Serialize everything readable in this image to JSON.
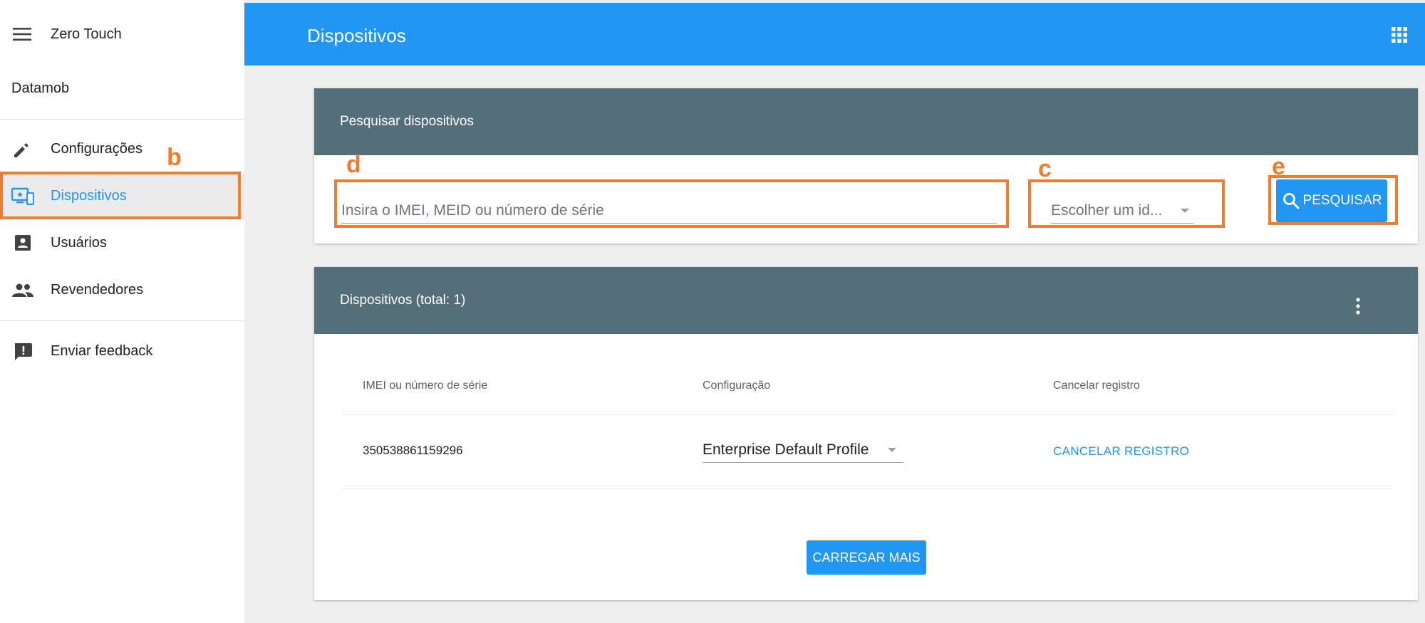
{
  "sidebar": {
    "app_title": "Zero Touch",
    "org_name": "Datamob",
    "items": [
      {
        "label": "Configurações",
        "icon": "pencil-icon",
        "active": false
      },
      {
        "label": "Dispositivos",
        "icon": "devices-icon",
        "active": true
      },
      {
        "label": "Usuários",
        "icon": "account-box-icon",
        "active": false
      },
      {
        "label": "Revendedores",
        "icon": "people-icon",
        "active": false
      }
    ],
    "feedback": {
      "label": "Enviar feedback",
      "icon": "feedback-icon"
    }
  },
  "header": {
    "title": "Dispositivos",
    "apps_icon": "apps-grid-icon"
  },
  "search_card": {
    "title": "Pesquisar dispositivos",
    "input_placeholder": "Insira o IMEI, MEID ou número de série",
    "id_select_value": "Escolher um id...",
    "search_button_label": "PESQUISAR"
  },
  "devices_card": {
    "title": "Dispositivos (total: 1)",
    "columns": [
      "IMEI ou número de série",
      "Configuração",
      "Cancelar registro"
    ],
    "rows": [
      {
        "imei": "350538861159296",
        "config": "Enterprise Default Profile",
        "action": "CANCELAR REGISTRO"
      }
    ],
    "load_more_label": "CARREGAR MAIS"
  },
  "annotations": {
    "b": "b",
    "c": "c",
    "d": "d",
    "e": "e",
    "color": "#ed7d31"
  },
  "colors": {
    "primary": "#2196f3",
    "card_header": "#546e7a",
    "sidebar_active_bg": "#ebebeb"
  }
}
